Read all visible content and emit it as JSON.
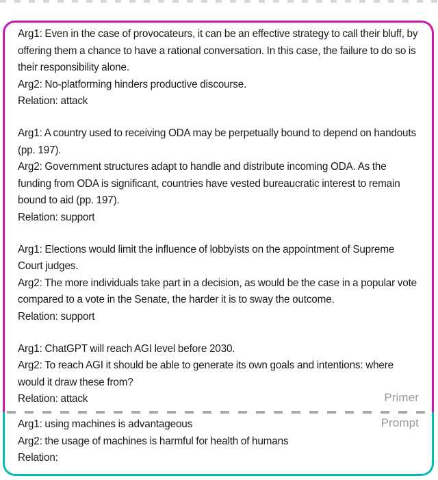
{
  "card": {
    "primer_label": "Primer",
    "prompt_label": "Prompt",
    "primer_border_color": "#c617b4",
    "prompt_border_color": "#00bfb3",
    "divider_color": "#a8a8a8",
    "label_color": "#9a9a9a",
    "text_color": "#1a1a1a"
  },
  "primer": {
    "examples": [
      {
        "arg1": "Arg1: Even in the case of provocateurs, it can be an effective strategy to call their bluff, by offering them a chance to have a rational conversation. In this case, the failure to do so is their responsibility alone.",
        "arg2": "Arg2: No-platforming hinders productive discourse.",
        "relation": "Relation: attack"
      },
      {
        "arg1": "Arg1: A country used to receiving ODA may be perpetually bound to depend on handouts (pp. 197).",
        "arg2": "Arg2: Government structures adapt to handle and distribute incoming ODA. As the funding from ODA is significant, countries have vested bureaucratic interest to remain bound to aid (pp. 197).",
        "relation": "Relation: support"
      },
      {
        "arg1": "Arg1: Elections would limit the influence of lobbyists on the appointment of Supreme Court judges.",
        "arg2": "Arg2: The more individuals take part in a decision, as would be the case in a popular vote compared to a vote in the Senate, the harder it is to sway the outcome.",
        "relation": "Relation: support"
      },
      {
        "arg1": "Arg1: ChatGPT will reach AGI level before 2030.",
        "arg2": "Arg2: To reach AGI it should be able to generate its own goals and intentions: where would it draw these from?",
        "relation": "Relation: attack"
      }
    ]
  },
  "prompt": {
    "arg1": "Arg1: using machines is advantageous",
    "arg2": "Arg2: the usage of machines is harmful for health of humans",
    "relation": "Relation:"
  }
}
